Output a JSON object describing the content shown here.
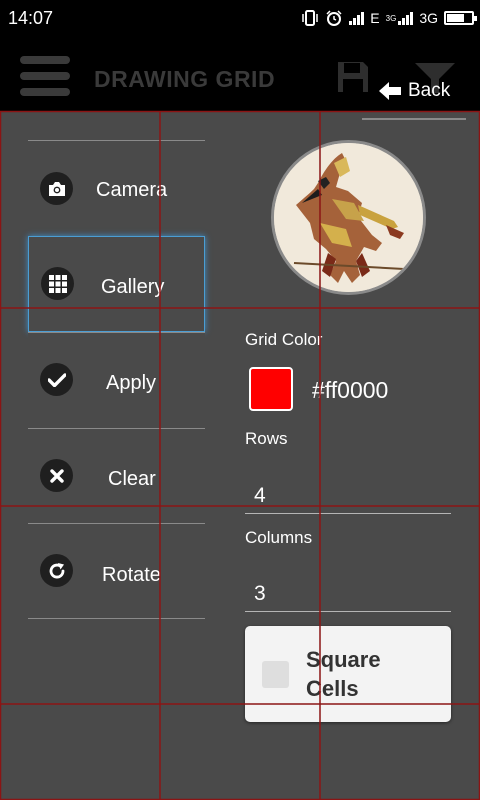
{
  "status_bar": {
    "time": "14:07",
    "network_e": "E",
    "network_3g_small": "3G",
    "network_3g": "3G",
    "battery_level": 0.65
  },
  "app_bar": {
    "title": "DRAWING GRID",
    "back_label": "Back",
    "icons": [
      "menu-icon",
      "save-icon",
      "filter-icon",
      "back-arrow-icon"
    ]
  },
  "actions": [
    {
      "label": "Camera",
      "icon": "camera-icon"
    },
    {
      "label": "Gallery",
      "icon": "grid-icon"
    },
    {
      "label": "Apply",
      "icon": "check-icon"
    },
    {
      "label": "Clear",
      "icon": "close-icon"
    },
    {
      "label": "Rotate",
      "icon": "refresh-icon"
    }
  ],
  "settings": {
    "grid_color_label": "Grid Color",
    "grid_color_value": "#ff0000",
    "grid_color_text": "#ff0000",
    "rows_label": "Rows",
    "rows_value": "4",
    "columns_label": "Columns",
    "columns_value": "3",
    "square_cells_label": "Square Cells",
    "square_cells_checked": false
  },
  "colors": {
    "background": "#4a4a4a",
    "bar": "#000000",
    "grid_line": "#8b1414",
    "active_outline": "#4b9ed4"
  }
}
